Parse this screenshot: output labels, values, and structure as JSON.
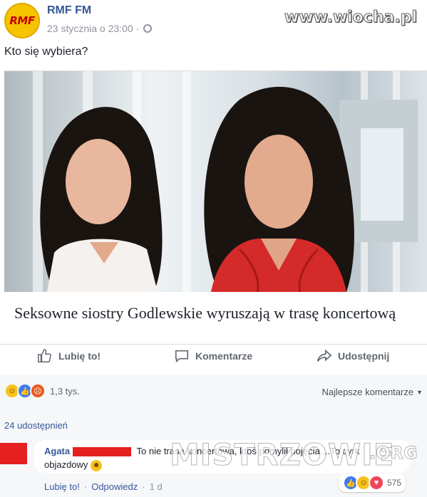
{
  "post": {
    "page_name": "RMF FM",
    "logo_text": "RMF FM",
    "timestamp": "23 stycznia o 23:00",
    "separator": "·",
    "status_text": "Kto się wybiera?"
  },
  "watermark_top": "www.wiocha.pl",
  "article": {
    "title": "Seksowne siostry Godlewskie wyruszają w trasę koncertową"
  },
  "actions": {
    "like": "Lubię to!",
    "comment": "Komentarze",
    "share": "Udostępnij"
  },
  "reactions": {
    "icons": [
      "haha-icon",
      "like-icon",
      "angry-icon"
    ],
    "count": "1,3 tys.",
    "sort_label": "Najlepsze komentarze"
  },
  "shares": "24 udostępnień",
  "comment": {
    "author": "Agata",
    "text": "To nie trasa koncertowa, ktoś pomylił pojęcia....To cyrk objazdowy",
    "reactions": [
      "like-icon",
      "haha-icon",
      "love-icon"
    ],
    "reaction_count": "575",
    "like_label": "Lubię to!",
    "separator": "·",
    "reply_label": "Odpowiedz",
    "time": "1 d"
  },
  "watermark_bottom": {
    "main": "MISTRZOWIE",
    "tld": ".ORG"
  },
  "colors": {
    "link": "#365899",
    "muted": "#90949c",
    "panel": "#f6f7f9",
    "accent_red": "#e61f1f"
  }
}
